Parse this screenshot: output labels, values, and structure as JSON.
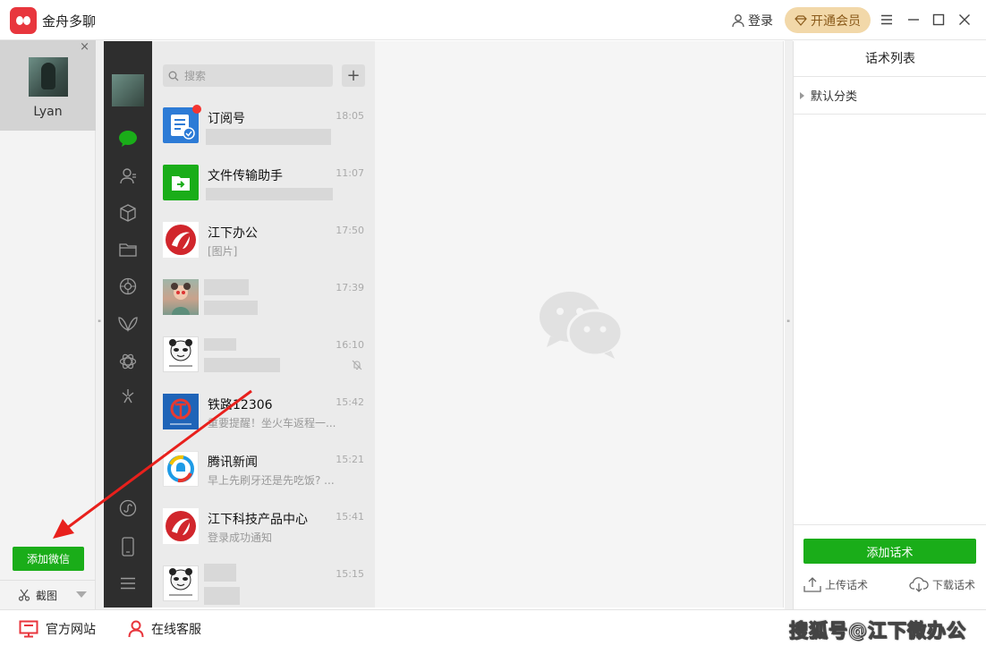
{
  "app": {
    "title": "金舟多聊",
    "login_label": "登录",
    "vip_label": "开通会员"
  },
  "accounts": [
    {
      "name": "Lyan"
    }
  ],
  "left": {
    "close_symbol": "×",
    "add_wechat_label": "添加微信",
    "screenshot_label": "截图"
  },
  "search": {
    "placeholder": "搜索"
  },
  "plus_symbol": "+",
  "chats": [
    {
      "name": "订阅号",
      "time": "18:05",
      "preview": "",
      "avatar": "subscription-icon"
    },
    {
      "name": "文件传输助手",
      "time": "11:07",
      "preview": "",
      "avatar": "file-transfer-icon"
    },
    {
      "name": "江下办公",
      "time": "17:50",
      "preview": "[图片]",
      "avatar": "jiangxia-logo"
    },
    {
      "name": "",
      "time": "17:39",
      "preview": "",
      "avatar": "contact-photo"
    },
    {
      "name": "",
      "time": "16:10",
      "preview": "",
      "avatar": "panda-meme"
    },
    {
      "name": "铁路12306",
      "time": "15:42",
      "preview": "重要提醒！坐火车返程一...",
      "avatar": "railway-logo"
    },
    {
      "name": "腾讯新闻",
      "time": "15:21",
      "preview": "早上先刷牙还是先吃饭? ...",
      "avatar": "tencent-news-logo"
    },
    {
      "name": "江下科技产品中心",
      "time": "15:41",
      "preview": "登录成功通知",
      "avatar": "jiangxia-logo"
    },
    {
      "name": "",
      "time": "15:15",
      "preview": "",
      "avatar": "panda-meme"
    }
  ],
  "scripts_panel": {
    "title": "话术列表",
    "category": "默认分类",
    "add_label": "添加话术",
    "upload_label": "上传话术",
    "download_label": "下载话术"
  },
  "footer": {
    "website_label": "官方网站",
    "service_label": "在线客服",
    "credit": "搜狐号@江下微办公"
  },
  "colors": {
    "accent_green": "#1aad19",
    "brand_red": "#e8363d",
    "vip_gold": "#f2d8a9",
    "annotation_red": "#e8201c"
  }
}
